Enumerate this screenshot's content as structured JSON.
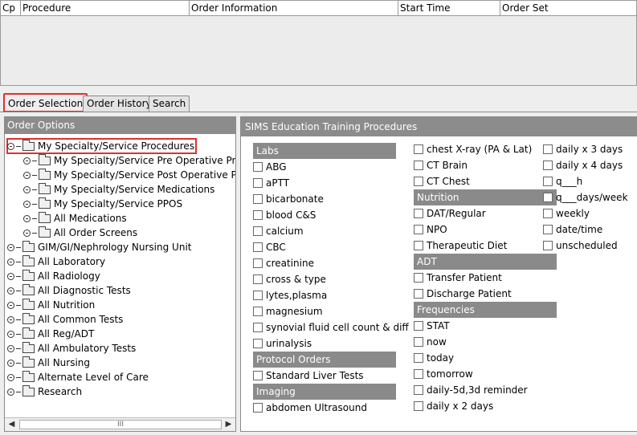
{
  "grid": {
    "columns": [
      "Cp",
      "Procedure",
      "Order Information",
      "Start Time",
      "Order Set"
    ]
  },
  "tabs": [
    "Order Selection",
    "Order History",
    "Search"
  ],
  "left_panel": {
    "title": "Order Options",
    "tree": [
      {
        "label": "My Specialty/Service Procedures",
        "level": 0,
        "expanded": true,
        "highlighted": true
      },
      {
        "label": "My Specialty/Service Pre Operative Prophy",
        "level": 1
      },
      {
        "label": "My Specialty/Service Post Operative Prophy",
        "level": 1
      },
      {
        "label": "My Specialty/Service Medications",
        "level": 1
      },
      {
        "label": "My Specialty/Service PPOS",
        "level": 1
      },
      {
        "label": "All Medications",
        "level": 1
      },
      {
        "label": "All Order Screens",
        "level": 1
      },
      {
        "label": "GIM/GI/Nephrology Nursing Unit",
        "level": 0
      },
      {
        "label": "All Laboratory",
        "level": 0
      },
      {
        "label": "All Radiology",
        "level": 0
      },
      {
        "label": "All Diagnostic Tests",
        "level": 0
      },
      {
        "label": "All Nutrition",
        "level": 0
      },
      {
        "label": "All Common Tests",
        "level": 0
      },
      {
        "label": "All Reg/ADT",
        "level": 0
      },
      {
        "label": "All Ambulatory Tests",
        "level": 0
      },
      {
        "label": "All Nursing",
        "level": 0
      },
      {
        "label": "Alternate Level of Care",
        "level": 0
      },
      {
        "label": "Research",
        "level": 0
      }
    ],
    "scroll_left": "◀",
    "scroll_right": "▶",
    "scroll_grip": "III"
  },
  "right_panel": {
    "title": "SIMS Education Training Procedures",
    "columns": [
      [
        {
          "section": "Labs"
        },
        {
          "item": "ABG"
        },
        {
          "item": "aPTT"
        },
        {
          "item": "bicarbonate"
        },
        {
          "item": "blood C&S"
        },
        {
          "item": "calcium"
        },
        {
          "item": "CBC"
        },
        {
          "item": "creatinine"
        },
        {
          "item": "cross & type"
        },
        {
          "item": "lytes,plasma"
        },
        {
          "item": "magnesium"
        },
        {
          "item": "synovial fluid cell count & diff"
        },
        {
          "item": "urinalysis"
        },
        {
          "section": "Protocol Orders"
        },
        {
          "item": "Standard Liver Tests"
        },
        {
          "section": "Imaging"
        },
        {
          "item": "abdomen Ultrasound"
        }
      ],
      [
        {
          "item": "chest X-ray (PA & Lat)"
        },
        {
          "item": "CT Brain"
        },
        {
          "item": "CT Chest"
        },
        {
          "section": "Nutrition"
        },
        {
          "item": "DAT/Regular"
        },
        {
          "item": "NPO"
        },
        {
          "item": "Therapeutic Diet"
        },
        {
          "section": "ADT"
        },
        {
          "item": "Transfer Patient"
        },
        {
          "item": "Discharge Patient"
        },
        {
          "section": "Frequencies"
        },
        {
          "item": "STAT"
        },
        {
          "item": "now"
        },
        {
          "item": "today"
        },
        {
          "item": "tomorrow"
        },
        {
          "item": "daily-5d,3d reminder"
        },
        {
          "item": "daily x 2 days"
        }
      ],
      [
        {
          "item": "daily x 3 days"
        },
        {
          "item": "daily x 4 days"
        },
        {
          "item": "q___h"
        },
        {
          "item": "q___days/week"
        },
        {
          "item": "weekly"
        },
        {
          "item": "date/time"
        },
        {
          "item": "unscheduled"
        }
      ]
    ]
  }
}
